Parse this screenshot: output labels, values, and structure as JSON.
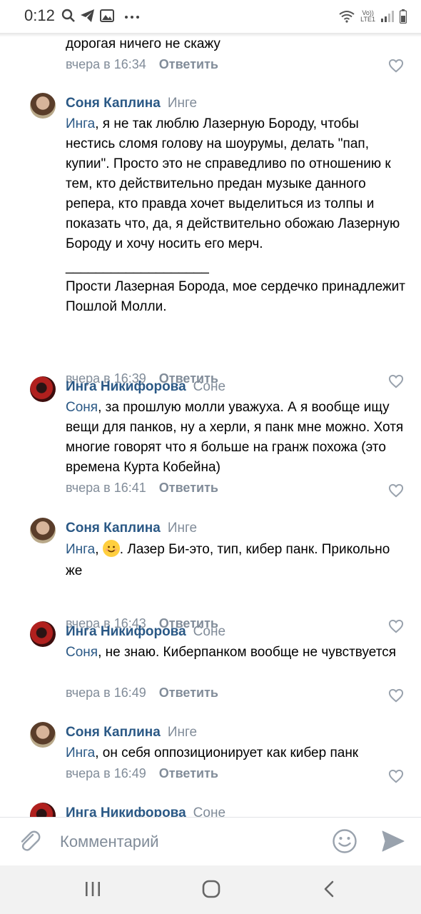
{
  "status_bar": {
    "time": "0:12",
    "network_label_top": "Vo))",
    "network_label_bottom": "LTE1"
  },
  "partial_top": {
    "text": "дорогая ничего не скажу",
    "time": "вчера в 16:34",
    "reply": "Ответить"
  },
  "comments": [
    {
      "author": "Соня Каплина",
      "reply_to": "Инге",
      "mention": "Инга",
      "text": ", я не так люблю Лазерную Бороду, чтобы нестись сломя голову на шоурумы, делать \"пап, купии\". Просто это не справедливо по отношению к тем, кто действительно предан музыке данного репера, кто правда хочет выделиться из толпы и показать что, да, я действительно обожаю Лазерную Бороду и хочу носить его мерч.",
      "separator": "___________________",
      "text2": "Прости Лазерная Борода, мое сердечко принадлежит Пошлой Молли.",
      "time": "вчера в 16:39",
      "reply": "Ответить"
    },
    {
      "author": "Инга Никифорова",
      "reply_to": "Соне",
      "mention": "Соня",
      "text": ", за прошлую молли уважуха. А я вообще ищу вещи для панков, ну а херли, я панк мне можно. Хотя многие говорят что я больше на гранж похожа (это времена Курта Кобейна)",
      "time": "вчера в 16:41",
      "reply": "Ответить"
    },
    {
      "author": "Соня Каплина",
      "reply_to": "Инге",
      "mention": "Инга",
      "text_before_emoji": ",",
      "text": ". Лазер Би-это, тип, кибер панк. Прикольно же",
      "time": "вчера в 16:43",
      "reply": "Ответить"
    },
    {
      "author": "Инга Никифорова",
      "reply_to": "Соне",
      "mention": "Соня",
      "text": ", не знаю. Киберпанком вообще не чувствуется",
      "time": "вчера в 16:49",
      "reply": "Ответить"
    },
    {
      "author": "Соня Каплина",
      "reply_to": "Инге",
      "mention": "Инга",
      "text": ", он себя оппозиционирует как кибер панк",
      "time": "вчера в 16:49",
      "reply": "Ответить"
    },
    {
      "author": "Инга Никифорова",
      "reply_to": "Соне"
    }
  ],
  "composer": {
    "placeholder": "Комментарий"
  },
  "colors": {
    "link": "#2a5885",
    "secondary": "#818c99",
    "send": "#99a2ad"
  }
}
